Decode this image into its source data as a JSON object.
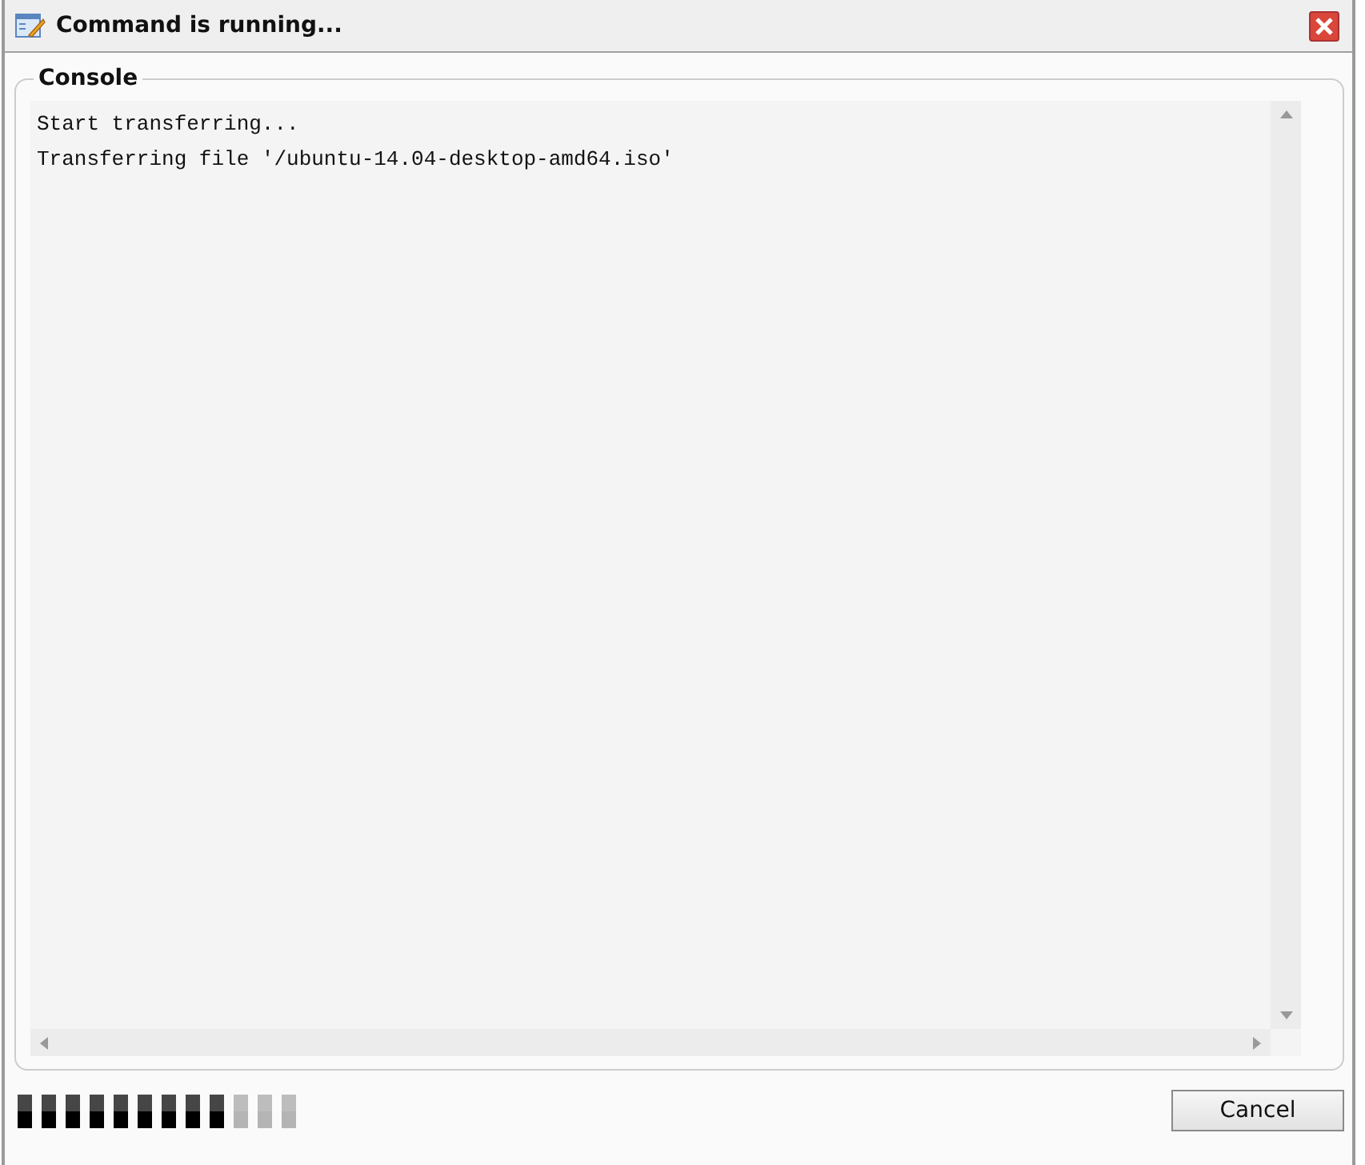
{
  "window": {
    "title": "Command is running..."
  },
  "console": {
    "legend": "Console",
    "lines": [
      "Start transferring...",
      "Transferring file '/ubuntu-14.04-desktop-amd64.iso'"
    ]
  },
  "progress": {
    "level": 0.75
  },
  "buttons": [
    {
      "label": "Cancel"
    }
  ]
}
